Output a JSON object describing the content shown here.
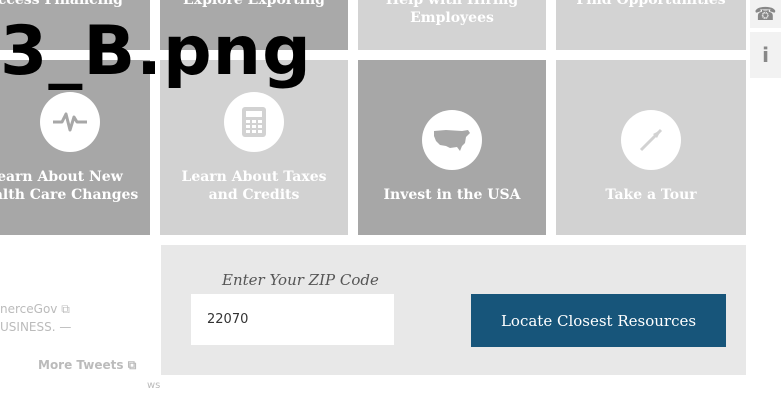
{
  "overlay": {
    "filename": "3_B.png"
  },
  "tiles_top": [
    {
      "label": "Access Financing"
    },
    {
      "label": "Explore Exporting"
    },
    {
      "label": "Help with Hiring Employees"
    },
    {
      "label": "Find Opportunities"
    }
  ],
  "tiles_bottom": [
    {
      "label": "Learn About New Health Care Changes",
      "icon": "heartbeat-icon"
    },
    {
      "label": "Learn About Taxes and Credits",
      "icon": "calculator-icon"
    },
    {
      "label": "Invest in the USA",
      "icon": "usa-map-icon"
    },
    {
      "label": "Take a Tour",
      "icon": "compass-icon"
    }
  ],
  "side_buttons": [
    {
      "icon": "phone-icon",
      "glyph": "☎"
    },
    {
      "icon": "info-icon",
      "glyph": "i"
    }
  ],
  "zip": {
    "label": "Enter Your ZIP Code",
    "value": "22070",
    "button_label": "Locate Closest Resources"
  },
  "twitter": {
    "handle": "nerceGov",
    "snippet": "USINESS. —",
    "more_label": "More Tweets",
    "partial": "ws"
  },
  "colors": {
    "tile_light": "#d2d2d2",
    "tile_dark": "#a7a7a7",
    "panel_bg": "#e8e8e8",
    "button_bg": "#17557a"
  }
}
